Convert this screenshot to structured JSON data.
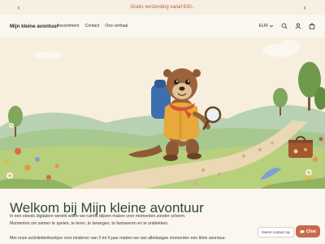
{
  "announcement": {
    "text": "Gratis verzending vanaf €30,-"
  },
  "header": {
    "logo": "Mijn kleine avontuur",
    "nav": [
      "Assortiment",
      "Contact",
      "Ons verhaal"
    ],
    "currency": "EUR",
    "icons": [
      "search-icon",
      "account-icon",
      "cart-icon"
    ]
  },
  "hero": {
    "illustration": "otter-explorer-with-magnifying-glass"
  },
  "main": {
    "title": "Welkom bij Mijn kleine avontuur",
    "paragraph1": "In een steeds digitalere wereld willen we ruimte blijven maken voor momenten zonder scherm.",
    "paragraph2": "Momenten om samen te spelen, te leren, te bewegen, te fantaseren en te ontdekken.",
    "paragraph3": "Met onze activiteitenboekjes voor kinderen van 3 tot 6 jaar maken we van alledaagse momenten een klein avontuur."
  },
  "widgets": {
    "contact_label": "Neem contact op",
    "chat_label": "Chat"
  },
  "colors": {
    "accent": "#c96a4e",
    "announcement_text": "#b85c3a",
    "title": "#2c4a30"
  }
}
